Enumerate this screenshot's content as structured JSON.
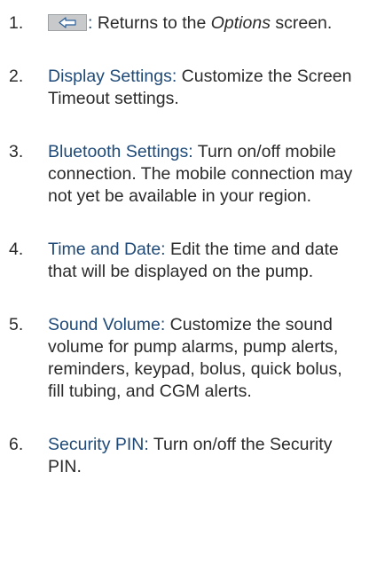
{
  "items": [
    {
      "num": "1.",
      "icon": "back-arrow-icon",
      "colon": ":",
      "text_before": " Returns to the ",
      "text_em": "Options",
      "text_after": " screen."
    },
    {
      "num": "2.",
      "term": "Display Settings:",
      "text": " Customize the Screen Timeout settings."
    },
    {
      "num": "3.",
      "term": "Bluetooth Settings:",
      "text": " Turn on/off mobile connection. The mobile connection may not yet be available in your region."
    },
    {
      "num": "4.",
      "term": "Time and Date:",
      "text": " Edit the time and date that will be displayed on the pump."
    },
    {
      "num": "5.",
      "term": "Sound Volume:",
      "text": " Customize the sound volume for pump alarms, pump alerts, reminders, keypad, bolus, quick bolus, fill tubing, and CGM alerts."
    },
    {
      "num": "6.",
      "term": "Security PIN:",
      "text": " Turn on/off the Security PIN."
    }
  ],
  "colors": {
    "term": "#1f4a78",
    "text": "#2b2b2b",
    "button_fill": "#c7c9cb",
    "button_arrow": "#ffffff",
    "button_arrow_outline": "#2b5f9a"
  }
}
